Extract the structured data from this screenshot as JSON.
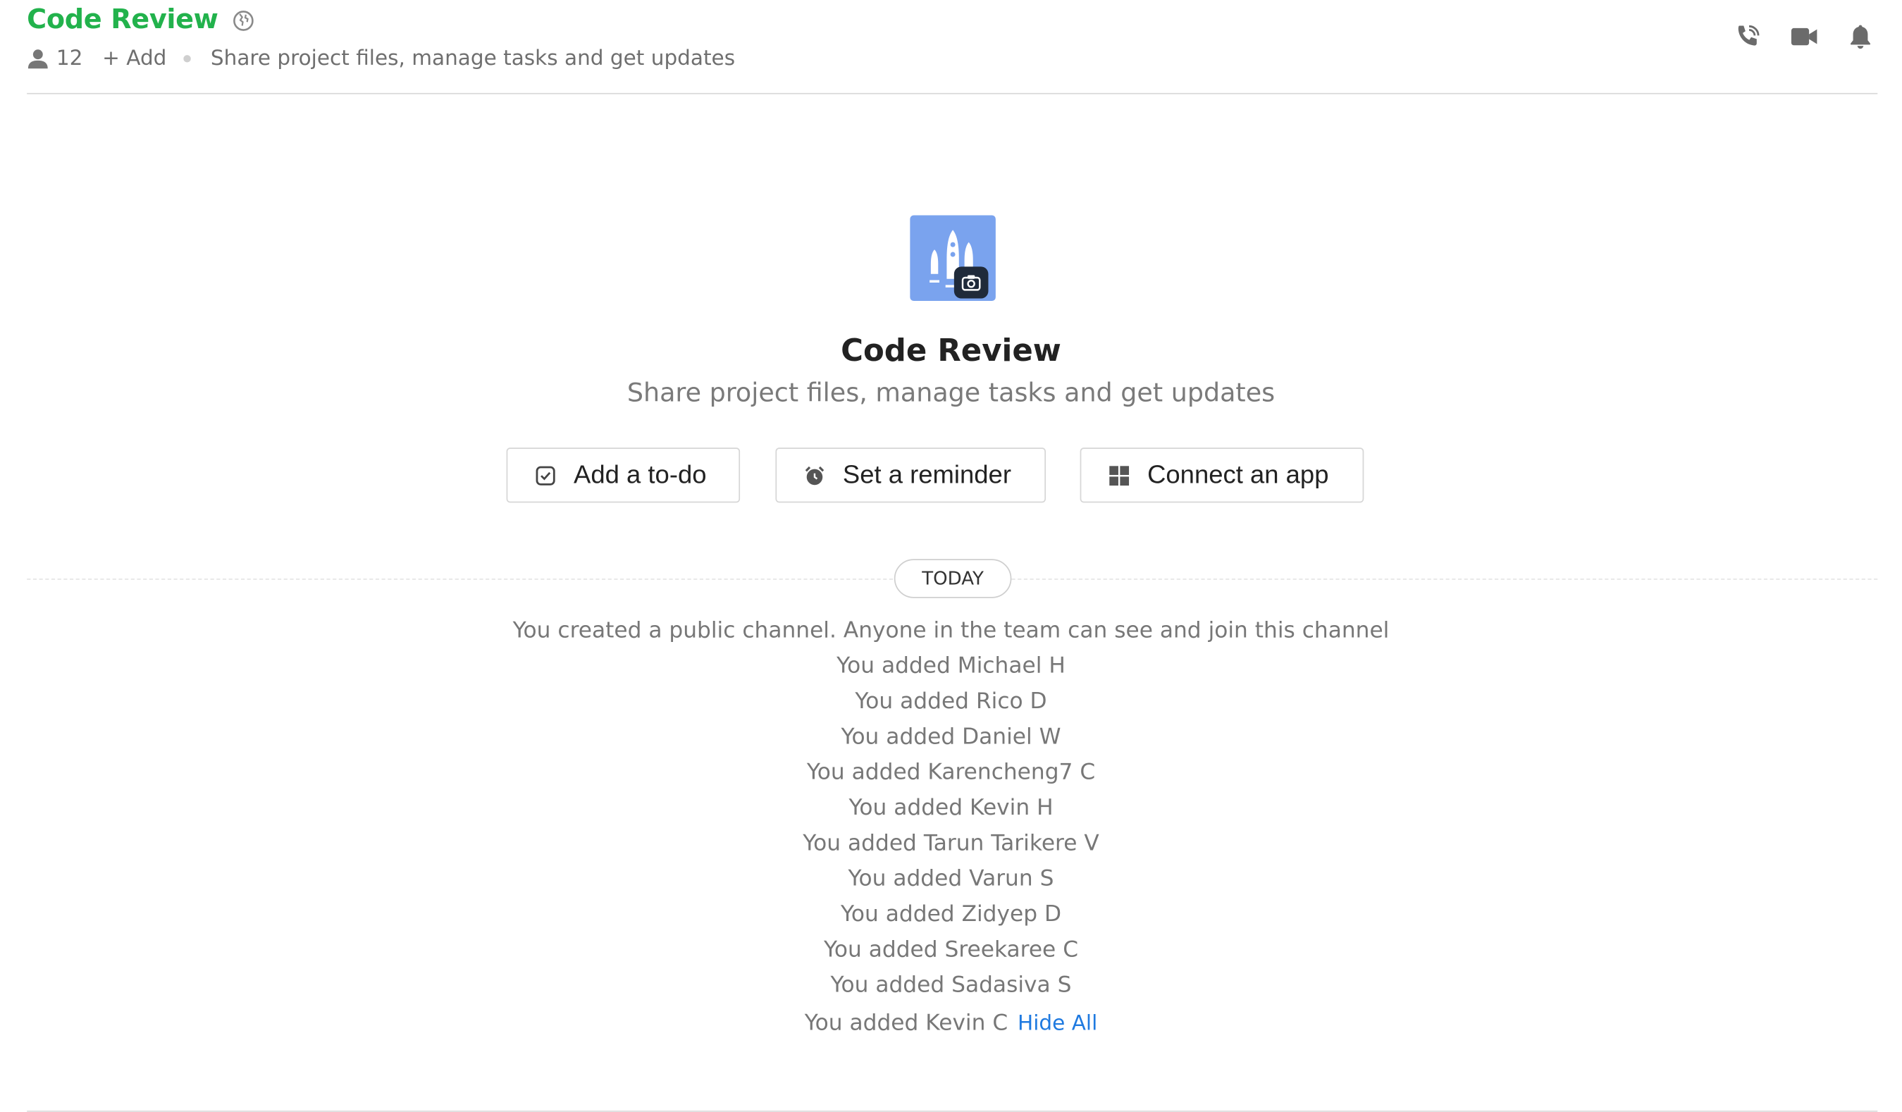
{
  "header": {
    "title": "Code Review",
    "member_count": "12",
    "add_label": "+ Add",
    "description": "Share project files, manage tasks and get updates",
    "icons": {
      "globe": "globe-icon",
      "members": "user-icon",
      "call": "phone-call-icon",
      "video": "video-camera-icon",
      "notifications": "bell-icon"
    }
  },
  "hero": {
    "channel_name": "Code Review",
    "channel_description": "Share project files, manage tasks and get updates",
    "image_color": "#7aa3ee"
  },
  "actions": [
    {
      "label": "Add a to-do",
      "icon": "checkbox-icon"
    },
    {
      "label": "Set a reminder",
      "icon": "alarm-clock-icon"
    },
    {
      "label": "Connect an app",
      "icon": "apps-grid-icon"
    }
  ],
  "timeline": {
    "day_label": "TODAY",
    "events": [
      "You created a public channel. Anyone in the team can see and join this channel",
      "You added Michael H",
      "You added Rico D",
      "You added Daniel W",
      "You added Karencheng7 C",
      "You added Kevin H",
      "You added Tarun Tarikere V",
      "You added Varun S",
      "You added Zidyep D",
      "You added Sreekaree C",
      "You added Sadasiva S",
      "You added Kevin C"
    ],
    "hide_all_label": "Hide All"
  },
  "colors": {
    "title": "#22b24c",
    "link": "#1f7ae0",
    "muted_text": "#777777"
  }
}
